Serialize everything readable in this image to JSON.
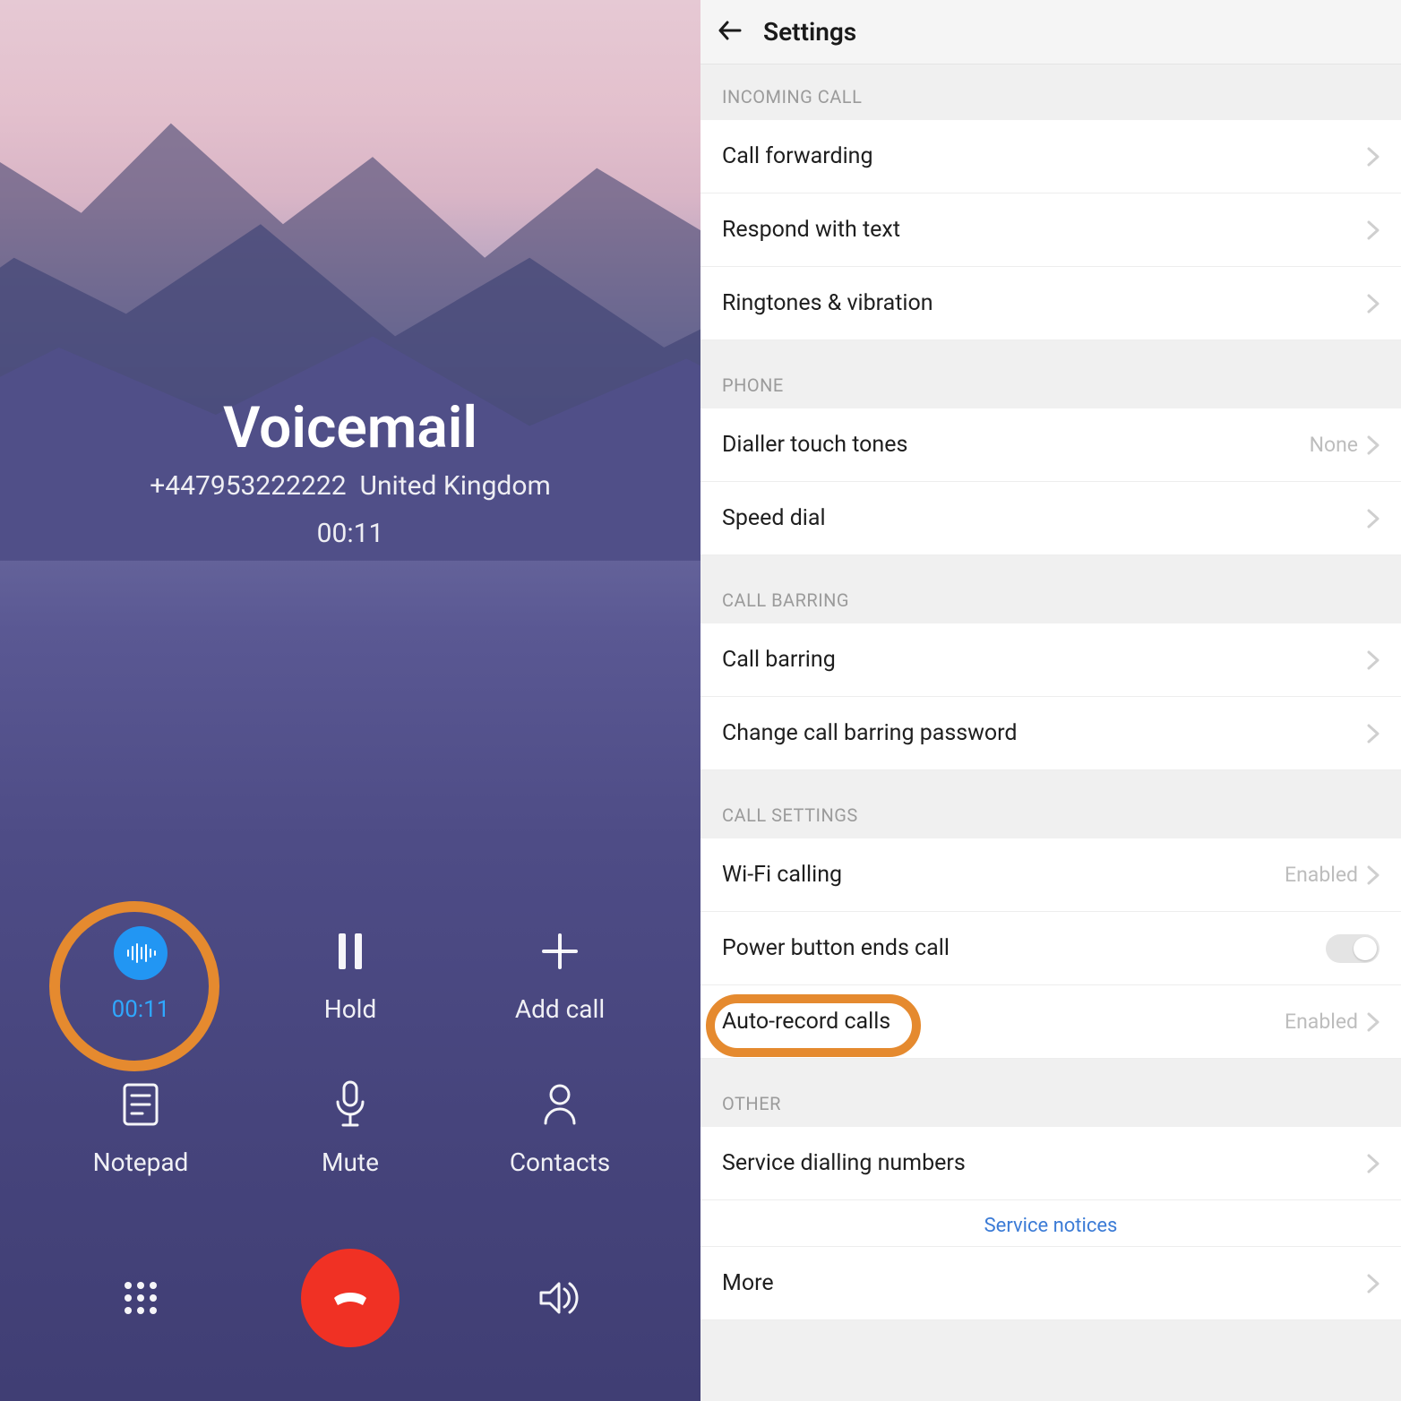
{
  "call": {
    "title": "Voicemail",
    "number": "+447953222222",
    "region": "United Kingdom",
    "duration": "00:11",
    "controls": {
      "record_timer": "00:11",
      "hold": "Hold",
      "add_call": "Add call",
      "notepad": "Notepad",
      "mute": "Mute",
      "contacts": "Contacts"
    }
  },
  "settings": {
    "title": "Settings",
    "sections": {
      "incoming_call": {
        "header": "INCOMING CALL",
        "call_forwarding": "Call forwarding",
        "respond_with_text": "Respond with text",
        "ringtones_vibration": "Ringtones & vibration"
      },
      "phone": {
        "header": "PHONE",
        "dialler_touch_tones": "Dialler touch tones",
        "dialler_touch_tones_value": "None",
        "speed_dial": "Speed dial"
      },
      "call_barring": {
        "header": "CALL BARRING",
        "call_barring": "Call barring",
        "change_password": "Change call barring password"
      },
      "call_settings": {
        "header": "CALL SETTINGS",
        "wifi_calling": "Wi-Fi calling",
        "wifi_calling_value": "Enabled",
        "power_button_ends_call": "Power button ends call",
        "auto_record_calls": "Auto-record calls",
        "auto_record_calls_value": "Enabled"
      },
      "other": {
        "header": "OTHER",
        "service_dialling_numbers": "Service dialling numbers",
        "service_notices": "Service notices",
        "more": "More"
      }
    }
  }
}
